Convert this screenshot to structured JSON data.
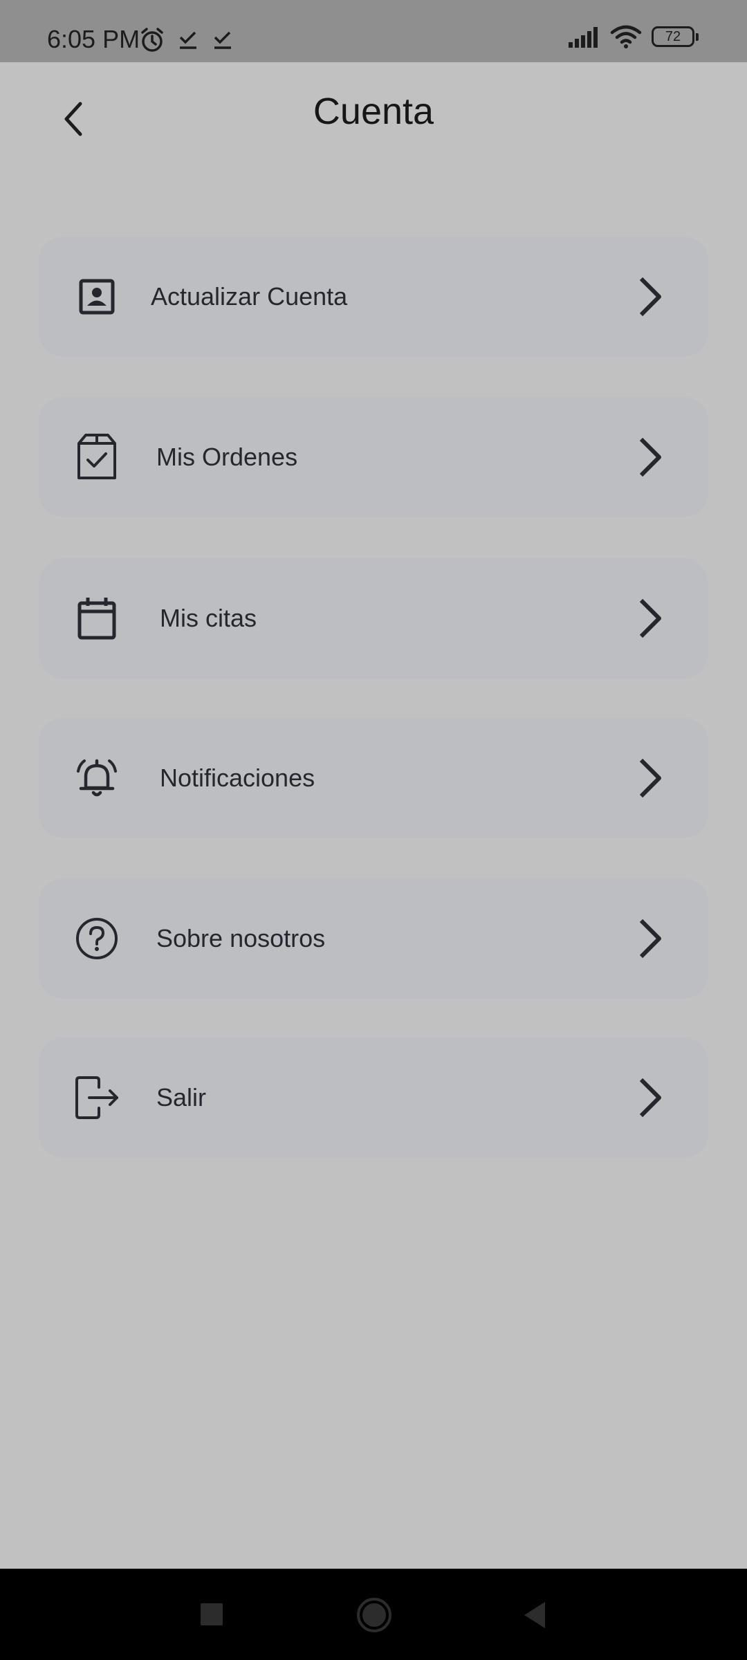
{
  "status_bar": {
    "time": "6:05 PM",
    "battery": "72",
    "icons": [
      "alarm-icon",
      "check-icon",
      "check-icon",
      "signal-icon",
      "wifi-icon",
      "battery-icon"
    ]
  },
  "header": {
    "title": "Cuenta",
    "back_icon": "chevron-left-icon"
  },
  "menu": {
    "items": [
      {
        "label": "Actualizar Cuenta",
        "icon": "contact-card-icon"
      },
      {
        "label": "Mis Ordenes",
        "icon": "box-check-icon"
      },
      {
        "label": "Mis citas",
        "icon": "calendar-icon"
      },
      {
        "label": "Notificaciones",
        "icon": "bell-ringing-icon"
      },
      {
        "label": "Sobre nosotros",
        "icon": "question-circle-icon"
      },
      {
        "label": "Salir",
        "icon": "logout-icon"
      }
    ]
  },
  "nav_bar": {
    "buttons": [
      "recents-square-icon",
      "home-circle-icon",
      "back-triangle-icon"
    ]
  },
  "colors": {
    "background": "#c1c1c1",
    "status_bar": "#8f8f8f",
    "card": "#bdbec2",
    "text": "#26262e",
    "nav_bar": "#000000"
  }
}
